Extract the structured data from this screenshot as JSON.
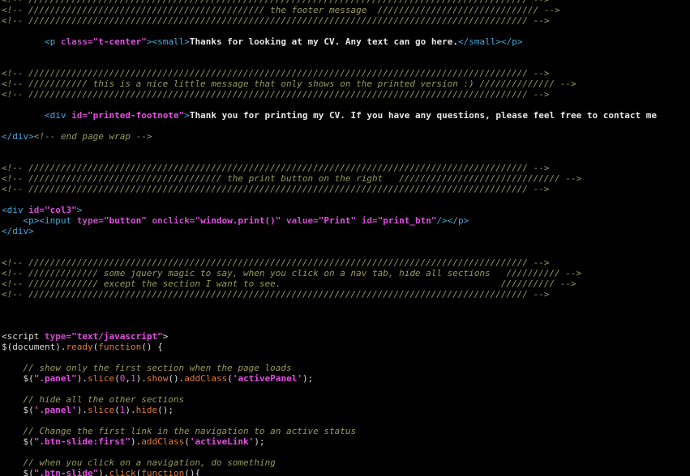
{
  "lines": [
    [
      {
        "c": "cmt",
        "t": "<!-- ///////////////////////////////////////////////////////////////////////////////////////////// -->"
      }
    ],
    [
      {
        "c": "cmt",
        "t": "<!-- //////////////////////////////////////////// the footer message  ////////////////////////////// -->"
      }
    ],
    [
      {
        "c": "cmt",
        "t": "<!-- ///////////////////////////////////////////////////////////////////////////////////////////// -->"
      }
    ],
    [],
    [
      {
        "c": "plain",
        "t": "        "
      },
      {
        "c": "tag",
        "t": "<p "
      },
      {
        "c": "attr",
        "t": "class="
      },
      {
        "c": "str",
        "t": "\"t-center\""
      },
      {
        "c": "tag",
        "t": "><small>"
      },
      {
        "c": "txt",
        "t": "Thanks for looking at my CV. Any text can go here."
      },
      {
        "c": "tag",
        "t": "</small></p>"
      }
    ],
    [],
    [],
    [
      {
        "c": "cmt",
        "t": "<!-- ///////////////////////////////////////////////////////////////////////////////////////////// -->"
      }
    ],
    [
      {
        "c": "cmt",
        "t": "<!-- /////////// this is a nice little message that only shows on the printed version :) ////////////// -->"
      }
    ],
    [
      {
        "c": "cmt",
        "t": "<!-- ///////////////////////////////////////////////////////////////////////////////////////////// -->"
      }
    ],
    [],
    [
      {
        "c": "plain",
        "t": "        "
      },
      {
        "c": "tag",
        "t": "<div "
      },
      {
        "c": "attr",
        "t": "id="
      },
      {
        "c": "str",
        "t": "\"printed-footnote\""
      },
      {
        "c": "tag",
        "t": ">"
      },
      {
        "c": "txt",
        "t": "Thank you for printing my CV. If you have any questions, please feel free to contact me"
      }
    ],
    [],
    [
      {
        "c": "tag",
        "t": "</div>"
      },
      {
        "c": "cmt",
        "t": "<!-- end page wrap -->"
      }
    ],
    [],
    [],
    [
      {
        "c": "cmt",
        "t": "<!-- ///////////////////////////////////////////////////////////////////////////////////////////// -->"
      }
    ],
    [
      {
        "c": "cmt",
        "t": "<!-- //////////////////////////////////// the print button on the right   ////////////////////////////// -->"
      }
    ],
    [
      {
        "c": "cmt",
        "t": "<!-- ///////////////////////////////////////////////////////////////////////////////////////////// -->"
      }
    ],
    [],
    [
      {
        "c": "tag",
        "t": "<div "
      },
      {
        "c": "attr",
        "t": "id="
      },
      {
        "c": "str",
        "t": "\"col3\""
      },
      {
        "c": "tag",
        "t": ">"
      }
    ],
    [
      {
        "c": "plain",
        "t": "    "
      },
      {
        "c": "tag",
        "t": "<p><input "
      },
      {
        "c": "attr",
        "t": "type="
      },
      {
        "c": "str",
        "t": "\"button\" "
      },
      {
        "c": "attr",
        "t": "onclick="
      },
      {
        "c": "str",
        "t": "\"window.print()\" "
      },
      {
        "c": "attr",
        "t": "value="
      },
      {
        "c": "str",
        "t": "\"Print\" "
      },
      {
        "c": "attr",
        "t": "id="
      },
      {
        "c": "str",
        "t": "\"print_btn\""
      },
      {
        "c": "tag",
        "t": "/></p>"
      }
    ],
    [
      {
        "c": "tag",
        "t": "</div>"
      }
    ],
    [],
    [],
    [
      {
        "c": "cmt",
        "t": "<!-- ///////////////////////////////////////////////////////////////////////////////////////////// -->"
      }
    ],
    [
      {
        "c": "cmt",
        "t": "<!-- ///////////// some jquery magic to say, when you click on a nav tab, hide all sections   ////////// -->"
      }
    ],
    [
      {
        "c": "cmt",
        "t": "<!-- ///////////// except the section I want to see.                                         ////////// -->"
      }
    ],
    [
      {
        "c": "cmt",
        "t": "<!-- ///////////////////////////////////////////////////////////////////////////////////////////// -->"
      }
    ],
    [],
    [],
    [],
    [
      {
        "c": "plain",
        "t": "<script "
      },
      {
        "c": "attr",
        "t": "type="
      },
      {
        "c": "str",
        "t": "\"text/javascript\""
      },
      {
        "c": "plain",
        "t": ">"
      }
    ],
    [
      {
        "c": "plain",
        "t": "$(document)."
      },
      {
        "c": "jsfn",
        "t": "ready"
      },
      {
        "c": "plain",
        "t": "("
      },
      {
        "c": "jskw",
        "t": "function"
      },
      {
        "c": "plain",
        "t": "() {"
      }
    ],
    [],
    [
      {
        "c": "plain",
        "t": "    "
      },
      {
        "c": "cmt",
        "t": "// show only the first section when the page loads"
      }
    ],
    [
      {
        "c": "plain",
        "t": "    $("
      },
      {
        "c": "jsstr",
        "t": "\".panel\""
      },
      {
        "c": "plain",
        "t": ")."
      },
      {
        "c": "jsfn",
        "t": "slice"
      },
      {
        "c": "plain",
        "t": "("
      },
      {
        "c": "jsnum",
        "t": "0"
      },
      {
        "c": "plain",
        "t": ","
      },
      {
        "c": "jsnum",
        "t": "1"
      },
      {
        "c": "plain",
        "t": ")."
      },
      {
        "c": "jsfn",
        "t": "show"
      },
      {
        "c": "plain",
        "t": "()."
      },
      {
        "c": "jsfn",
        "t": "addClass"
      },
      {
        "c": "plain",
        "t": "("
      },
      {
        "c": "jsstr",
        "t": "'activePanel'"
      },
      {
        "c": "plain",
        "t": ");"
      }
    ],
    [],
    [
      {
        "c": "plain",
        "t": "    "
      },
      {
        "c": "cmt",
        "t": "// hide all the other sections"
      }
    ],
    [
      {
        "c": "plain",
        "t": "    $("
      },
      {
        "c": "jsstr",
        "t": "'.panel'"
      },
      {
        "c": "plain",
        "t": ")."
      },
      {
        "c": "jsfn",
        "t": "slice"
      },
      {
        "c": "plain",
        "t": "("
      },
      {
        "c": "jsnum",
        "t": "1"
      },
      {
        "c": "plain",
        "t": ")."
      },
      {
        "c": "jsfn",
        "t": "hide"
      },
      {
        "c": "plain",
        "t": "();"
      }
    ],
    [],
    [
      {
        "c": "plain",
        "t": "    "
      },
      {
        "c": "cmt",
        "t": "// Change the first link in the navigation to an active status"
      }
    ],
    [
      {
        "c": "plain",
        "t": "    $("
      },
      {
        "c": "jsstr",
        "t": "\".btn-slide:first\""
      },
      {
        "c": "plain",
        "t": ")."
      },
      {
        "c": "jsfn",
        "t": "addClass"
      },
      {
        "c": "plain",
        "t": "("
      },
      {
        "c": "jsstr",
        "t": "'activeLink'"
      },
      {
        "c": "plain",
        "t": ");"
      }
    ],
    [],
    [
      {
        "c": "plain",
        "t": "    "
      },
      {
        "c": "cmt",
        "t": "// when you click on a navigation, do something"
      }
    ],
    [
      {
        "c": "plain",
        "t": "    $("
      },
      {
        "c": "jsstr",
        "t": "\".btn-slide\""
      },
      {
        "c": "plain",
        "t": ")."
      },
      {
        "c": "jsfn",
        "t": "click"
      },
      {
        "c": "plain",
        "t": "("
      },
      {
        "c": "jskw",
        "t": "function"
      },
      {
        "c": "plain",
        "t": "(){"
      }
    ]
  ]
}
